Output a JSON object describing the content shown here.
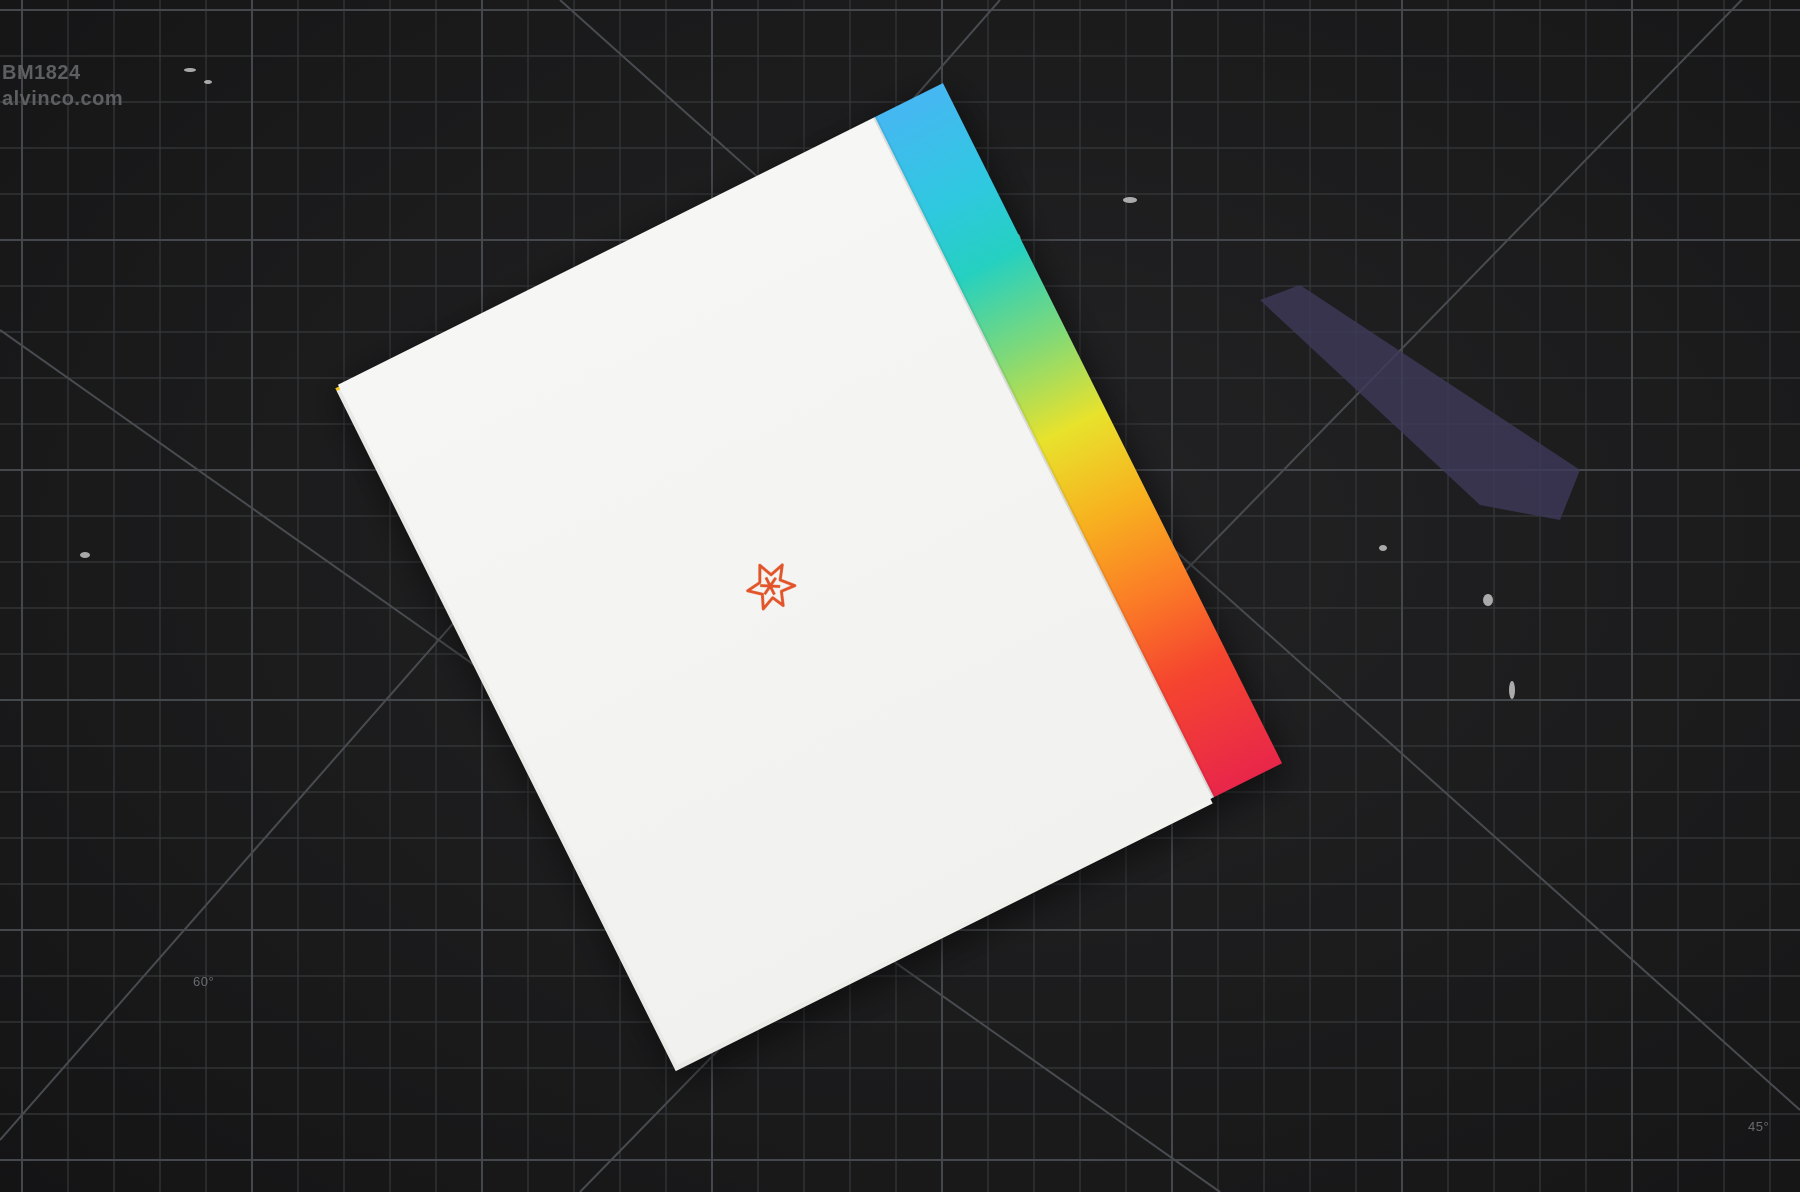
{
  "mat": {
    "model_code": "BM1824",
    "brand_url": "alvinco.com",
    "angle_60": "60°",
    "angle_45": "45°",
    "grid_color": "#3a3c3f",
    "diagonal_color": "#45484c"
  },
  "booklet": {
    "cover_color": "#f4f4f2",
    "spine_gradient": [
      "#46b7f2",
      "#25d0c0",
      "#e8e22c",
      "#fb7d26",
      "#e8264a"
    ],
    "logo_icon": "asterisk-flower-icon",
    "logo_color": "#e2542a"
  }
}
